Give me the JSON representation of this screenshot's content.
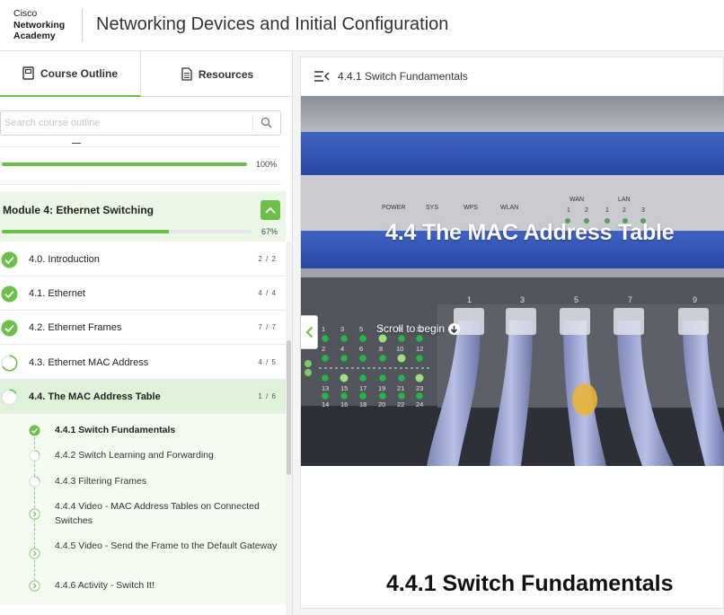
{
  "header": {
    "logo": {
      "line1": "Cisco",
      "line2": "Networking",
      "line3": "Academy"
    },
    "title": "Networking Devices and Initial Configuration"
  },
  "sidebar": {
    "tabs": [
      {
        "label": "Course Outline",
        "icon": "book-icon",
        "active": true
      },
      {
        "label": "Resources",
        "icon": "document-icon",
        "active": false
      }
    ],
    "search": {
      "placeholder": "Search course outline",
      "value": ""
    },
    "previous_module": {
      "percent_label": "100%",
      "progress": 1.0
    },
    "module": {
      "title": "Module 4: Ethernet Switching",
      "percent_label": "67%",
      "progress": 0.67,
      "expanded": true
    },
    "topics": [
      {
        "label": "4.0. Introduction",
        "count": "2 / 2",
        "status": "complete"
      },
      {
        "label": "4.1. Ethernet",
        "count": "4 / 4",
        "status": "complete"
      },
      {
        "label": "4.2. Ethernet Frames",
        "count": "7 / 7",
        "status": "complete"
      },
      {
        "label": "4.3. Ethernet MAC Address",
        "count": "4 / 5",
        "status": "partial"
      },
      {
        "label": "4.4. The MAC Address Table",
        "count": "1 / 6",
        "status": "partial",
        "active": true
      }
    ],
    "subtopics": [
      {
        "label": "4.4.1 Switch Fundamentals",
        "status": "complete",
        "active": true
      },
      {
        "label": "4.4.2 Switch Learning and Forwarding",
        "status": "none"
      },
      {
        "label": "4.4.3 Filtering Frames",
        "status": "none"
      },
      {
        "label": "4.4.4 Video - MAC Address Tables on Connected Switches",
        "status": "next"
      },
      {
        "label": "4.4.5 Video - Send the Frame to the Default Gateway",
        "status": "next"
      },
      {
        "label": "4.4.6 Activity - Switch It!",
        "status": "next"
      }
    ]
  },
  "main": {
    "header_title": "4.4.1 Switch Fundamentals",
    "hero": {
      "title": "4.4 The MAC Address Table",
      "scroll_hint": "Scroll to begin",
      "panel_labels": [
        "POWER",
        "SYS",
        "WPS",
        "WLAN",
        "WAN",
        "LAN",
        "1",
        "2",
        "1",
        "2",
        "3"
      ],
      "port_numbers_top": [
        "1",
        "3",
        "5",
        "7",
        "9",
        "11"
      ],
      "port_numbers_bottom": [
        "2",
        "4",
        "6",
        "8",
        "10",
        "12"
      ],
      "port_numbers_row3": [
        "13",
        "15",
        "17",
        "19",
        "21",
        "23"
      ],
      "port_numbers_row4": [
        "14",
        "16",
        "18",
        "20",
        "22",
        "24"
      ],
      "jack_numbers": [
        "1",
        "3",
        "5",
        "7",
        "9"
      ]
    },
    "section_title": "4.4.1 Switch Fundamentals"
  },
  "colors": {
    "accent_green": "#6cc04a",
    "module_bg": "#eaf6e6",
    "active_topic_bg": "#e0f3da"
  }
}
